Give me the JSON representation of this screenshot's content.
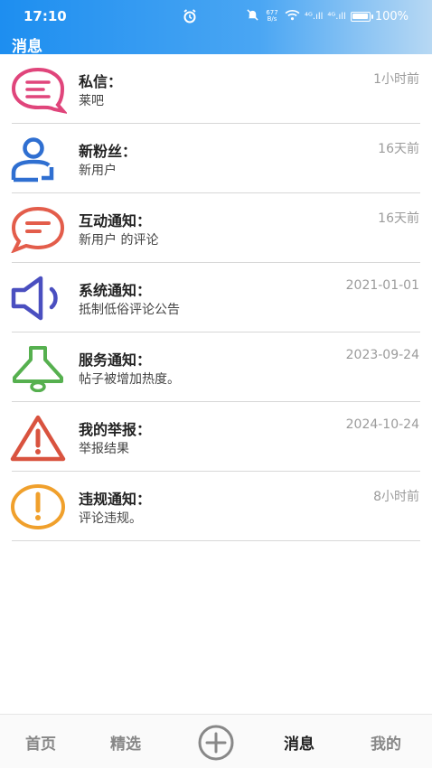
{
  "status_bar": {
    "time": "17:10",
    "net_speed_top": "677",
    "net_speed_bottom": "B/s",
    "signal_1": "⁴ᴳ.ıll",
    "signal_2": "⁴ᴳ.ıll",
    "battery": "100%",
    "battery_level": 1.0
  },
  "header": {
    "title": "消息"
  },
  "messages": [
    {
      "title": "私信：",
      "subtitle": "莱吧",
      "time": "1小时前",
      "icon": "chat-bubble-icon",
      "color": "#e0457b"
    },
    {
      "title": "新粉丝：",
      "subtitle": "新用户",
      "time": "16天前",
      "icon": "user-add-icon",
      "color": "#2f6fd1"
    },
    {
      "title": "互动通知：",
      "subtitle": "新用户 的评论",
      "time": "16天前",
      "icon": "comment-icon",
      "color": "#e35d4b"
    },
    {
      "title": "系统通知：",
      "subtitle": "抵制低俗评论公告",
      "time": "2021-01-01",
      "icon": "speaker-icon",
      "color": "#4a4fc0"
    },
    {
      "title": "服务通知：",
      "subtitle": "帖子被增加热度。",
      "time": "2023-09-24",
      "icon": "bell-icon",
      "color": "#56b04f"
    },
    {
      "title": "我的举报：",
      "subtitle": "举报结果",
      "time": "2024-10-24",
      "icon": "warning-icon",
      "color": "#d9533f"
    },
    {
      "title": "违规通知：",
      "subtitle": "评论违规。",
      "time": "8小时前",
      "icon": "exclamation-icon",
      "color": "#f0a02c"
    }
  ],
  "tabbar": {
    "home": "首页",
    "featured": "精选",
    "add_icon": "plus-circle-icon",
    "messages": "消息",
    "mine": "我的"
  }
}
